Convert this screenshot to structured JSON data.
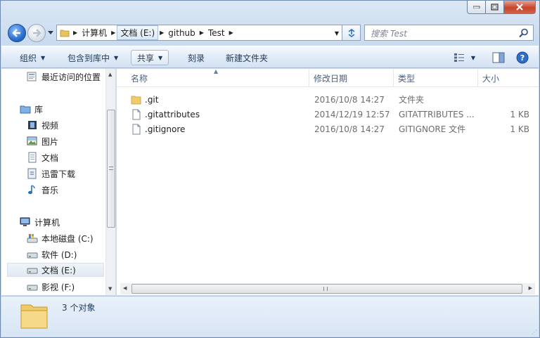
{
  "window": {
    "title_buttons": {
      "minimize": "minimize-icon",
      "maximize": "maximize-icon",
      "close": "close-icon"
    }
  },
  "address_bar": {
    "crumbs": [
      "计算机",
      "文档 (E:)",
      "github",
      "Test"
    ],
    "selected_crumb": "文档 (E:)"
  },
  "search": {
    "placeholder": "搜索 Test"
  },
  "toolbar": {
    "organize": "组织",
    "include_in_library": "包含到库中",
    "share": "共享",
    "burn": "刻录",
    "new_folder": "新建文件夹"
  },
  "nav_pane": {
    "items": [
      {
        "label": "最近访问的位置",
        "icon": "recent-places-icon"
      },
      {
        "label": "库",
        "icon": "libraries-icon"
      },
      {
        "label": "视频",
        "icon": "video-icon"
      },
      {
        "label": "图片",
        "icon": "pictures-icon"
      },
      {
        "label": "文档",
        "icon": "documents-icon"
      },
      {
        "label": "迅雷下载",
        "icon": "thunder-download-icon"
      },
      {
        "label": "音乐",
        "icon": "music-icon"
      },
      {
        "label": "计算机",
        "icon": "computer-icon"
      },
      {
        "label": "本地磁盘 (C:)",
        "icon": "drive-c-icon"
      },
      {
        "label": "软件 (D:)",
        "icon": "drive-icon"
      },
      {
        "label": "文档 (E:)",
        "icon": "drive-icon"
      },
      {
        "label": "影视 (F:)",
        "icon": "drive-icon"
      }
    ],
    "selected": "文档 (E:)"
  },
  "file_list": {
    "columns": [
      "名称",
      "修改日期",
      "类型",
      "大小"
    ],
    "rows": [
      {
        "name": ".git",
        "modified": "2016/10/8 14:27",
        "type": "文件夹",
        "size": "",
        "icon": "folder-icon"
      },
      {
        "name": ".gitattributes",
        "modified": "2014/12/19 12:57",
        "type": "GITATTRIBUTES ...",
        "size": "1 KB",
        "icon": "file-icon"
      },
      {
        "name": ".gitignore",
        "modified": "2016/10/8 14:27",
        "type": "GITIGNORE 文件",
        "size": "1 KB",
        "icon": "file-icon"
      }
    ]
  },
  "details_pane": {
    "text": "3 个对象",
    "icon": "folder-large-icon"
  },
  "colors": {
    "accent": "#1e395b",
    "chrome": "#dbe7f5",
    "selection": "#e2e9f2"
  }
}
